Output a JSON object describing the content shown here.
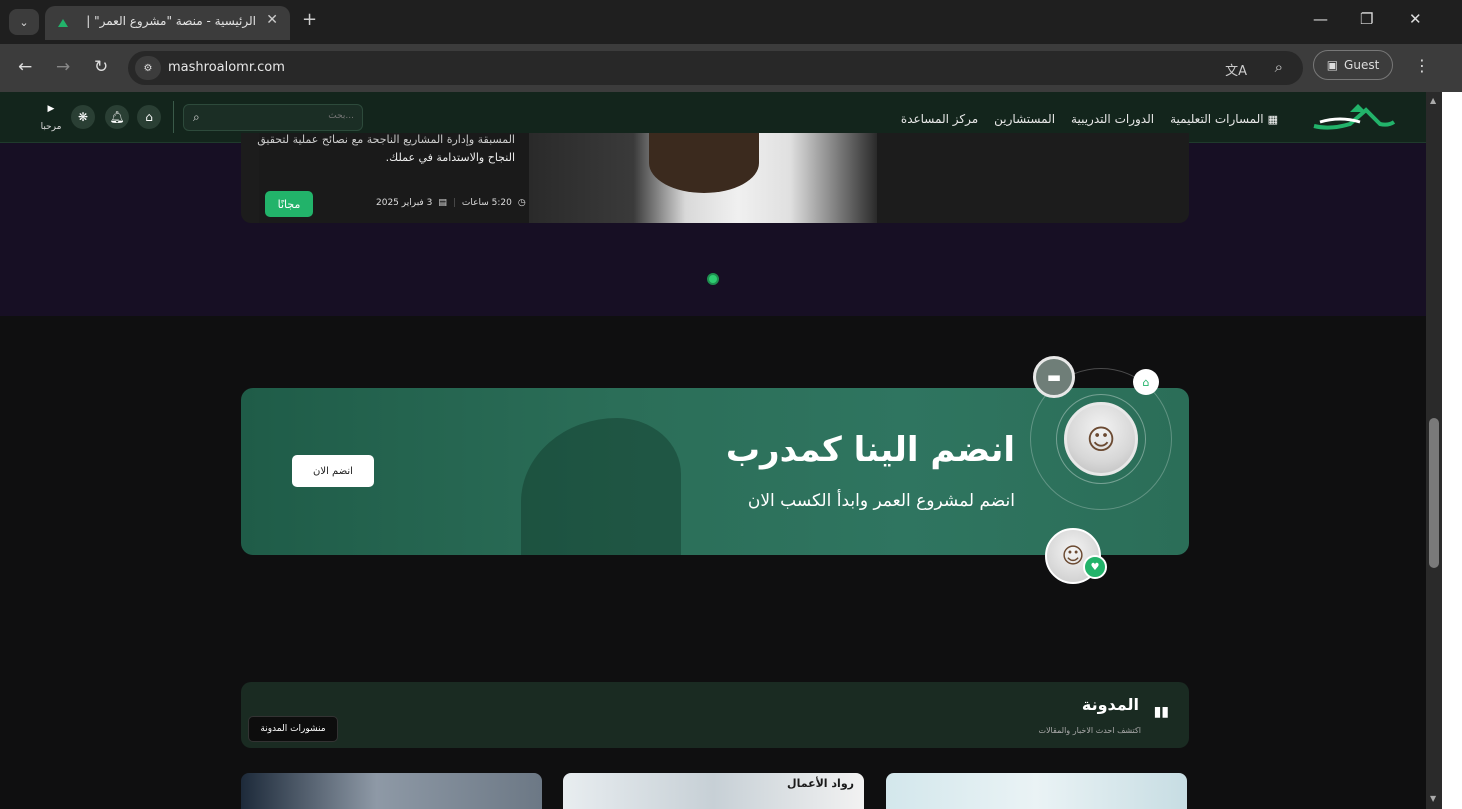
{
  "browser": {
    "tab_title": "الرئيسية - منصة \"مشروع العمر\" |",
    "url": "mashroalomr.com",
    "guest_label": "Guest"
  },
  "header": {
    "nav": [
      "المسارات التعليمية",
      "الدورات التدريبية",
      "المستشارين",
      "مركز المساعدة"
    ],
    "search_placeholder": "بحث...",
    "welcome": "مرحبا"
  },
  "hero": {
    "desc_line1": "المسبقة وإدارة المشاريع الناجحة مع نصائح عملية لتحقيق",
    "desc_line2": "النجاح والاستدامة في عملك.",
    "duration": "5:20 ساعات",
    "date": "3 فبراير 2025",
    "free_label": "مجانًا"
  },
  "trainer_banner": {
    "title": "انضم الينا كمدرب",
    "subtitle": "انضم لمشروع العمر وابدأ الكسب الان",
    "button_label": "انضم الان"
  },
  "blog": {
    "title": "المدونة",
    "subtitle": "اكتشف احدث الاخبار والمقالات",
    "button_label": "منشورات المدونة",
    "card2_caption": "رواد الأعمال"
  },
  "colors": {
    "accent": "#22b36a",
    "header_bg": "#13251c",
    "hero_bg": "#170f24",
    "banner_bg": "#2b6e58"
  }
}
